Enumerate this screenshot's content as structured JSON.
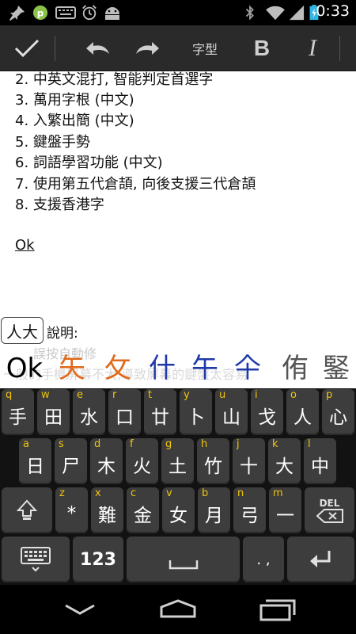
{
  "status_bar": {
    "time": "0:33",
    "icons": [
      "pin-icon",
      "app-icon",
      "keyboard-icon",
      "alarm-icon",
      "android-icon",
      "bluetooth-icon",
      "wifi-icon",
      "signal-icon",
      "battery-icon"
    ]
  },
  "toolbar": {
    "done_icon": "check-icon",
    "undo_icon": "undo-icon",
    "redo_icon": "redo-icon",
    "font_label": "字型",
    "bold_label": "B",
    "italic_label": "I"
  },
  "document": {
    "lines": [
      "2. 中英文混打, 智能判定首選字",
      "3. 萬用字根 (中文)",
      "4. 入繁出簡 (中文)",
      "5. 鍵盤手勢",
      "6. 詞語學習功能 (中文)",
      "7. 使用第五代倉頡, 向後支援三代倉頡",
      "8. 支援香港字"
    ],
    "ok_text": "Ok"
  },
  "candidate_bar": {
    "composing": "人大",
    "label": "說明:",
    "hint_line1": "誤按自動修",
    "hint_line2": "一般的手機屏幕不大,導致屏幕的鍵盤太容易",
    "candidates": [
      {
        "text": "Ok",
        "color": "#000000"
      },
      {
        "text": "矢",
        "color": "#e06a1b"
      },
      {
        "text": "攵",
        "color": "#e06a1b"
      },
      {
        "text": "什",
        "color": "#1f3aa8"
      },
      {
        "text": "午",
        "color": "#1f3aa8"
      },
      {
        "text": "仐",
        "color": "#1f3aa8"
      },
      {
        "text": "侑",
        "color": "#555555"
      },
      {
        "text": "鋻",
        "color": "#555555"
      }
    ]
  },
  "keyboard": {
    "row1": [
      {
        "hint": "q",
        "label": "手"
      },
      {
        "hint": "w",
        "label": "田"
      },
      {
        "hint": "e",
        "label": "水"
      },
      {
        "hint": "r",
        "label": "口"
      },
      {
        "hint": "t",
        "label": "廿"
      },
      {
        "hint": "y",
        "label": "卜"
      },
      {
        "hint": "u",
        "label": "山"
      },
      {
        "hint": "i",
        "label": "戈"
      },
      {
        "hint": "o",
        "label": "人"
      },
      {
        "hint": "p",
        "label": "心"
      }
    ],
    "row2": [
      {
        "hint": "a",
        "label": "日"
      },
      {
        "hint": "s",
        "label": "尸"
      },
      {
        "hint": "d",
        "label": "木"
      },
      {
        "hint": "f",
        "label": "火"
      },
      {
        "hint": "g",
        "label": "土"
      },
      {
        "hint": "h",
        "label": "竹"
      },
      {
        "hint": "j",
        "label": "十"
      },
      {
        "hint": "k",
        "label": "大"
      },
      {
        "hint": "l",
        "label": "中"
      }
    ],
    "row3": [
      {
        "hint": "z",
        "label": "*"
      },
      {
        "hint": "x",
        "label": "難"
      },
      {
        "hint": "c",
        "label": "金"
      },
      {
        "hint": "v",
        "label": "女"
      },
      {
        "hint": "b",
        "label": "月"
      },
      {
        "hint": "n",
        "label": "弓"
      },
      {
        "hint": "m",
        "label": "一"
      }
    ],
    "shift_icon": "shift-icon",
    "delete_label": "DEL",
    "keyboard_switch_icon": "keyboard-icon",
    "numbers_label": "123",
    "space_icon": "space-icon",
    "punct_label": ". ,",
    "enter_icon": "enter-icon"
  },
  "nav_bar": {
    "icons": [
      "back-icon",
      "home-icon",
      "recent-apps-icon"
    ]
  }
}
